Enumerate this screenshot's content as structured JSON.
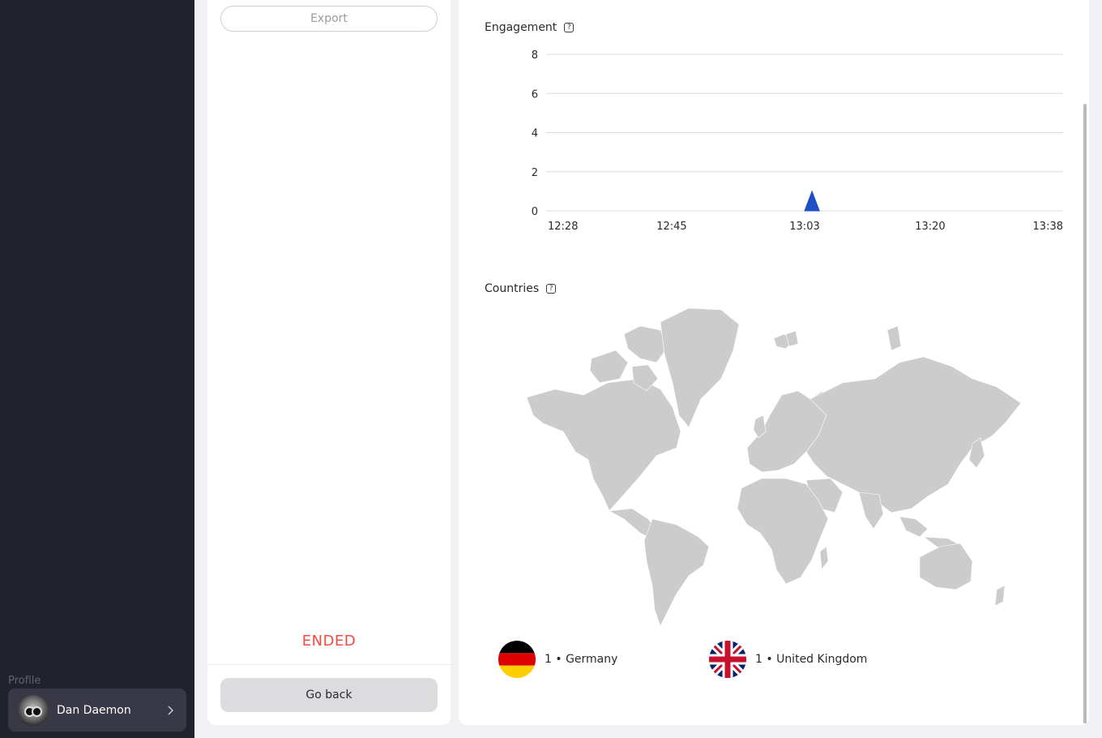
{
  "sidebar": {
    "profile_caption": "Profile",
    "profile_name": "Dan Daemon"
  },
  "left_panel": {
    "export_label": "Export",
    "status": "ENDED",
    "go_back_label": "Go back"
  },
  "engagement": {
    "title": "Engagement",
    "help_icon": "question-icon"
  },
  "countries": {
    "title": "Countries",
    "help_icon": "question-icon",
    "items": [
      {
        "label": "1 • Germany",
        "flag": "germany-flag-icon"
      },
      {
        "label": "1 • United Kingdom",
        "flag": "united-kingdom-flag-icon"
      }
    ]
  },
  "colors": {
    "accent": "#1f4fc4",
    "status_red": "#ef4b3f",
    "map_land": "#cccccc"
  },
  "chart_data": {
    "type": "area",
    "title": "Engagement",
    "x_ticks": [
      "12:28",
      "12:45",
      "13:03",
      "13:20",
      "13:38"
    ],
    "y_ticks": [
      "0",
      "2",
      "4",
      "6",
      "8"
    ],
    "ylim": [
      0,
      8
    ],
    "grid": true,
    "series": [
      {
        "x": [
          "13:03",
          "13:04",
          "13:05"
        ],
        "values": [
          0,
          1,
          0
        ]
      }
    ]
  }
}
